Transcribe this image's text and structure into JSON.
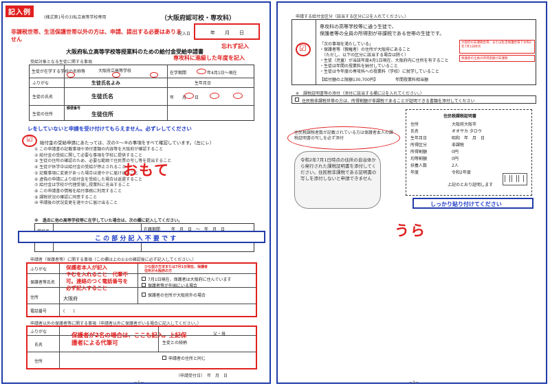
{
  "front": {
    "tag": "記入例",
    "form_no": "(様式第1号の3)私立高等学校専用",
    "school_type": "（大阪府認可校・専攻科）",
    "note_non_taxed": "非課税世帯、生活保護世帯以外の方は、申請、提出する必要はありません",
    "filing_date_label": "記入日",
    "filing_date_value": "年　　月　　日",
    "dont_forget": "忘れず記入",
    "title": "大阪府私立高等学校等授業料のための給付金受給申請書",
    "enrolled_year_note": "専攻科に進級した年度を記入",
    "target_label": "受給対象となる生徒に関する事項",
    "school_name_label": "生徒が在学する学校の名称等",
    "school_name_value": "大阪府立高等学校",
    "enroll_year_label": "在学期間",
    "enroll_year_value": "年4月1日～現在",
    "furigana_label": "ふりがな",
    "student_furigana": "生徒氏名よみ",
    "student_name_label": "生徒の氏名",
    "student_name_value": "生徒氏名",
    "birth_label": "生年月日",
    "birth_value": "年　　月　　日",
    "address_label": "生徒の住所",
    "address_value": "生徒住所",
    "postal_value": "郵便番号",
    "checkbox_warning": "レをしていないと申請を受け付けてもらえません。必ずレしてください",
    "consent_text": "給付金の受給申請にあたっては、次の①～⑩の事項をすべて確認しています。（左にレ）",
    "conditions": [
      "① この申請書の記載事項や添付書類の内容等を大阪府が確認すること",
      "② 給付金の受給に関して必要な事項を学校に提供すること",
      "③ 生徒の住所の確認のため、必要な範囲で住民票の写し等を提出すること",
      "④ 生徒が休学中は給付金の受給が停止されること",
      "⑤ 記載事項に変更があった場合は速やかに届け出ること",
      "⑥ 虚偽の申請により給付金を受給した場合は返還すること",
      "⑦ 給付金は学校が代理受領し授業料に充当すること",
      "⑧ この申請書の情報を給付事務に利用すること",
      "⑨ 課税状況の確認に同意すること",
      "⑩ 申請後の状況変更を速やかに届け出ること"
    ],
    "omote_stamp": "おもて",
    "past_enrollment": "※　過去に他の高等学校等に在学していた場合は、次の欄に記入してください。",
    "past_school_label": "学校名",
    "past_period_label": "在籍期間",
    "past_period_value": "年　月　日　～　年　月　日",
    "no_entry_banner": "こ の 部 分 記 入 不 要 で す",
    "guardian_section": "申請者（保護者等）に関する事項（この欄は上の①②の確認後に必ず記入してください。）",
    "guardian_instructions": "保護者本人が記入\nやむを入れること　代筆不可。連絡のつく電話番号を必ず記入すること",
    "guardian_small_note": "ひな型の方法または7月1日現在、保護者住所が大阪府の方",
    "guardian_furigana_label": "ふりがな",
    "guardian_name_label": "保護者等氏名",
    "guardian_address_label": "住所",
    "guardian_address_value": "大阪府",
    "guardian_phone_label": "電話番号",
    "guardian_phone_value": "(　　)",
    "guardian_option_1": "7月1日現在、保護者は大阪府に住んでいます",
    "guardian_option_2": "保護者等が外国にいる場合",
    "guardian_option_3": "保護者の住所が大阪府外の場合",
    "second_guardian_section": "申請者以外の保護者等に関する事項（申請者以外に保護者がいる場合に記入してください。）",
    "second_guardian_instructions": "保護者が2名の場合は、ここも記入。上記保護者による代筆可",
    "second_name_label": "氏名",
    "second_address_label": "住所",
    "relation_label": "生徒との続柄",
    "relation_value": "父・母",
    "same_address_option": "申請者の住所と同じ",
    "submit_date": "（申請受付日）　年　月　日",
    "page_no": "－1－"
  },
  "back": {
    "applicable_section": "申請する給付金区分（該当する区分に☑を入れてください。）",
    "applicable_text_1": "専攻科の高等学校等に通う生徒で、",
    "applicable_text_2": "保護者等の全員の所得割が非課税である世帯の生徒です。",
    "requirements_label": "「次の事項を満たしている」",
    "requirement_list": [
      "・保護者等（親権者）の住所が大阪府にあること",
      "　（ただし、以下の区分に該当する場合は除く）",
      "・生徒（児童）が当該年度4月1日現在、大阪府内に住所を有すること",
      "・生徒は年間の授業料を納付していること",
      "・生徒は今年度の専攻科への授業料（学校）に就学していること"
    ],
    "requirement_amount": "【給付額の上限額130,700円】",
    "requirement_note": "年間授業料相当額",
    "red_note_1": "大阪府の非課税世帯、または生活保護世帯で令和2年7月1日時点",
    "red_note_2": "保護者の全員の所得割額が非課税",
    "reference_section": "※　課税証明書等の添付（添付に該当する欄に☑を入れてください。）",
    "reference_text": "住民税非課税世帯の方は、所得割額が非課税であることが証明できる書類を添付してください",
    "ellipse_note": "住民税課税者数が記載されている方は保護者本人の課税証明書の写しを必ず添付",
    "paste_note": "令和2年7月1日時点の住所の自治体から発行された課税証明書を添付してください。住民税非課税である証明書の写しを添付しないと申請できません",
    "paste_instruction": "しっかり貼り付けてください",
    "ura_stamp": "うら",
    "certificate_title": "住民税課税証明書",
    "certificate_rows": [
      [
        "住所",
        "大阪府大阪市"
      ],
      [
        "氏名",
        "オオサカ タロウ"
      ],
      [
        "生年月日",
        "昭和　年　月　日"
      ],
      [
        "所得区分",
        "非課税"
      ],
      [
        "所得割額",
        "0円"
      ],
      [
        "均等割額",
        "0円"
      ],
      [
        "扶養人数",
        "2人"
      ],
      [
        "年度",
        "令和2年度"
      ]
    ],
    "certificate_footer": "上記のとおり証明します",
    "page_no": "－2－"
  }
}
